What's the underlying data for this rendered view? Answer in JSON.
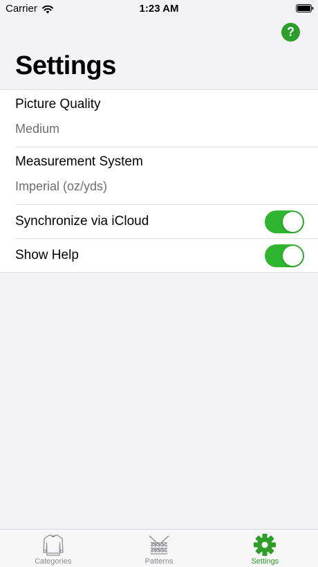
{
  "status_bar": {
    "carrier": "Carrier",
    "time": "1:23 AM"
  },
  "nav": {
    "title": "Settings",
    "help_label": "?"
  },
  "settings": {
    "picture_quality": {
      "label": "Picture Quality",
      "value": "Medium"
    },
    "measurement_system": {
      "label": "Measurement System",
      "value": "Imperial (oz/yds)"
    },
    "icloud_sync": {
      "label": "Synchronize via iCloud",
      "enabled": true
    },
    "show_help": {
      "label": "Show Help",
      "enabled": true
    }
  },
  "tabbar": {
    "items": [
      {
        "label": "Categories",
        "icon": "sweater-icon",
        "active": false
      },
      {
        "label": "Patterns",
        "icon": "knitting-pattern-icon",
        "active": false
      },
      {
        "label": "Settings",
        "icon": "gear-icon",
        "active": true
      }
    ]
  },
  "colors": {
    "accent": "#2e9e2a",
    "switch_on": "#2fb52f",
    "background": "#f2f2f7",
    "secondary_text": "#6d6d72",
    "inactive_tab": "#8e8e93"
  }
}
